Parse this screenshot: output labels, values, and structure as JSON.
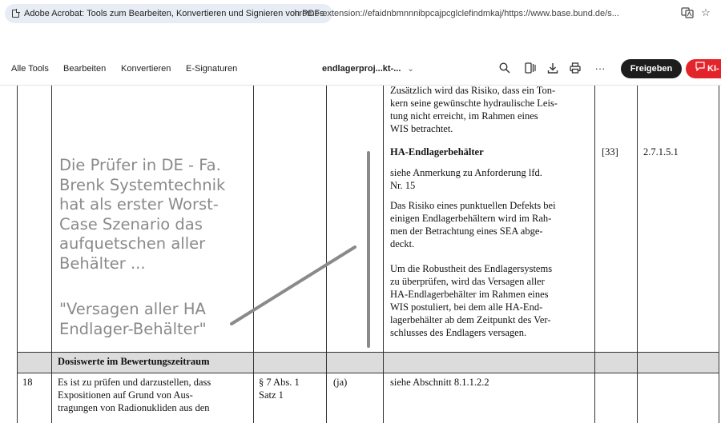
{
  "browser": {
    "tab_title": "Adobe Acrobat: Tools zum Bearbeiten, Konvertieren und Signieren von PDFs",
    "url": "chrome-extension://efaidnbmnnnibpcajpcglclefindmkaj/https://www.base.bund.de/s..."
  },
  "toolbar": {
    "menu": [
      "Alle Tools",
      "Bearbeiten",
      "Konvertieren",
      "E-Signaturen"
    ],
    "doc_title": "endlagerproj...kt-...",
    "share_label": "Freigeben",
    "ai_label": "KI-"
  },
  "document": {
    "top_text": [
      "Zusätzlich wird das Risiko, dass ein Ton-",
      "kern seine gewünschte hydraulische Leis-",
      "tung nicht erreicht, im Rahmen eines",
      "WIS betrachtet."
    ],
    "heading": "HA-Endlagerbehälter",
    "ref": "[33]",
    "section": "2.7.1.5.1",
    "para1": [
      "siehe Anmerkung zu Anforderung lfd.",
      "Nr. 15"
    ],
    "para2": [
      "Das Risiko eines punktuellen Defekts bei",
      "einigen Endlagerbehältern wird im Rah-",
      "men der Betrachtung eines SEA abge-",
      "deckt."
    ],
    "para3": [
      "Um die Robustheit des Endlagersystems",
      "zu überprüfen, wird das Versagen aller",
      "HA-Endlagerbehälter im Rahmen eines",
      "WIS postuliert, bei dem alle HA-End-",
      "lagerbehälter ab dem Zeitpunkt des Ver-",
      "schlusses des Endlagers versagen."
    ],
    "section_row": "Dosiswerte im Bewertungszeitraum",
    "row18": {
      "nr": "18",
      "requirement": [
        "Es ist zu prüfen und darzustellen, dass",
        "Expositionen auf Grund von Aus-",
        "tragungen von Radionukliden aus den"
      ],
      "legal": [
        "§ 7 Abs. 1",
        "Satz 1"
      ],
      "ja": "(ja)",
      "note": "siehe Abschnitt 8.1.1.2.2"
    }
  },
  "annotation": {
    "lines": [
      "Die Prüfer in DE - Fa.",
      "Brenk Systemtechnik",
      "hat als erster Worst-",
      "Case Szenario das",
      "aufquetschen aller",
      "Behälter ..."
    ],
    "quote": [
      "\"Versagen aller HA",
      "Endlager-Behälter\""
    ],
    "color": "#8a8a8a"
  }
}
